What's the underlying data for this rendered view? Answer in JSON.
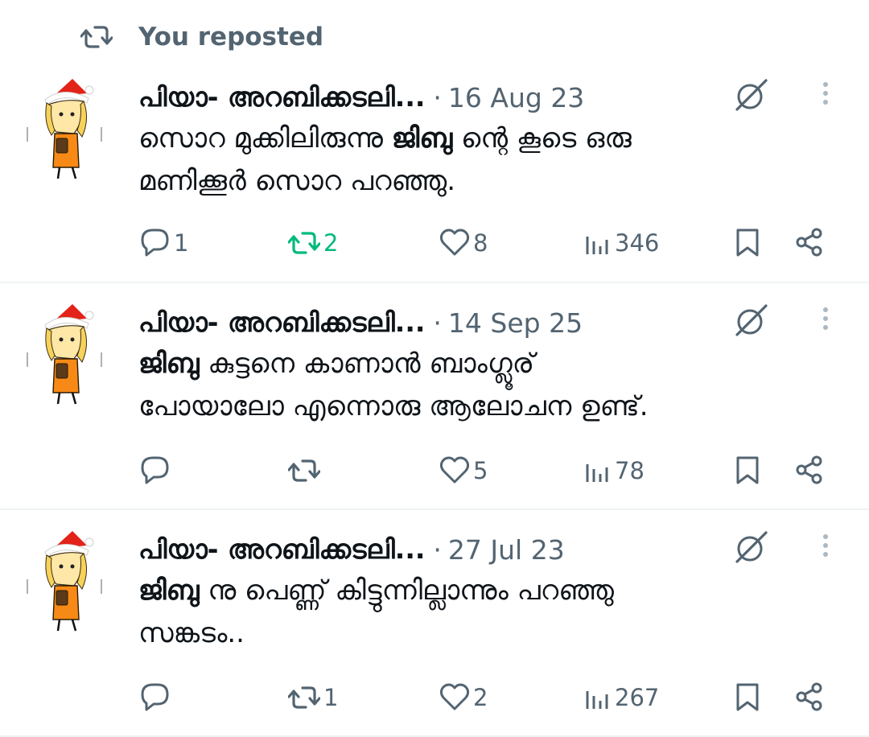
{
  "banner": {
    "label": "You reposted"
  },
  "colors": {
    "secondary": "#536471",
    "repost_active": "#00ba7c",
    "text": "#0f1419",
    "divider": "#eff3f4"
  },
  "tweets": [
    {
      "author": "പിയാ- അറബിക്കടലി...",
      "dot": "·",
      "date": "16 Aug 23",
      "text_line1_a": "സൊറ മുക്കിലിരുന്നു ",
      "text_line1_bold": "ജിബു",
      "text_line1_b": " ന്റെ കൂടെ ഒരു",
      "text_line2": "മണിക്കൂർ സൊറ പറഞ്ഞു.",
      "stats": {
        "replies": "1",
        "reposts": "2",
        "likes": "8",
        "views": "346"
      },
      "reposted_by_me": true
    },
    {
      "author": "പിയാ- അറബിക്കടലി...",
      "dot": "·",
      "date": "14 Sep 25",
      "text_line1_bold": "ജിബു",
      "text_line1_b": " കുട്ടനെ കാണാൻ ബാംഗ്ലൂര്",
      "text_line2": "പോയാലോ എന്നൊരു ആലോചന ഉണ്ട്.",
      "stats": {
        "replies": "",
        "reposts": "",
        "likes": "5",
        "views": "78"
      },
      "reposted_by_me": false
    },
    {
      "author": "പിയാ- അറബിക്കടലി...",
      "dot": "·",
      "date": "27 Jul 23",
      "text_line1_bold": "ജിബു",
      "text_line1_b": " നു പെണ്ണ് കിട്ടുന്നില്ലാന്നും പറഞ്ഞു",
      "text_line2": "സങ്കടം..",
      "stats": {
        "replies": "",
        "reposts": "1",
        "likes": "2",
        "views": "267"
      },
      "reposted_by_me": false
    }
  ]
}
